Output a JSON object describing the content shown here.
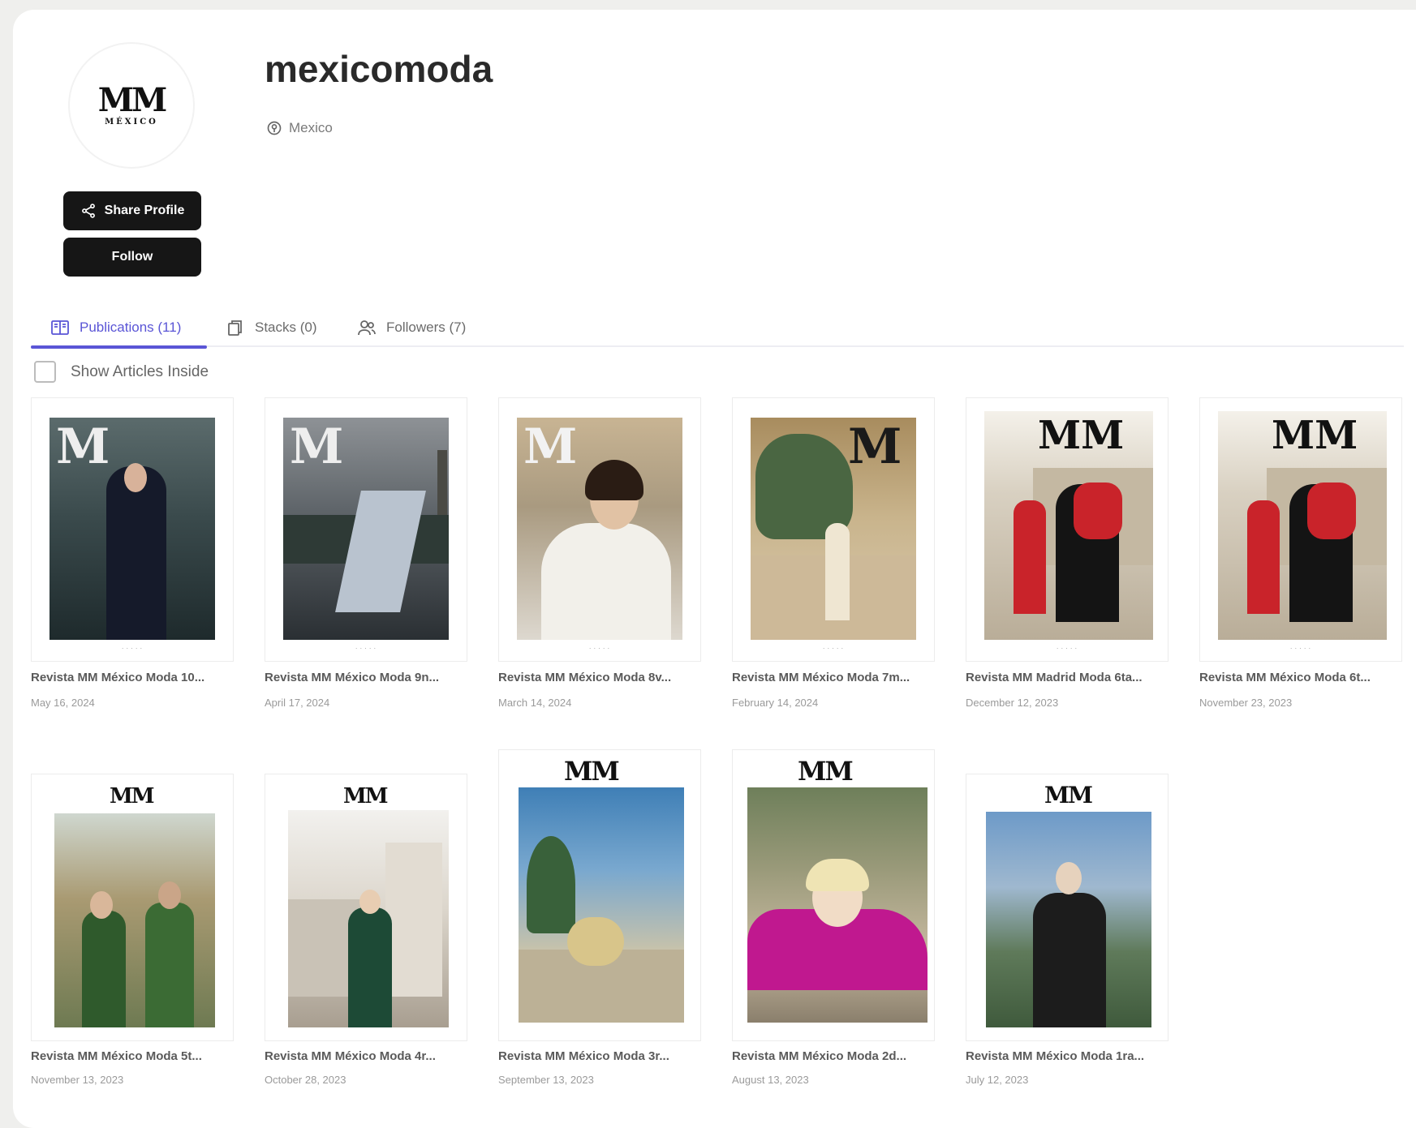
{
  "profile": {
    "name": "mexicomoda",
    "location": "Mexico",
    "logo_text": "MM",
    "logo_sub": "MÉXICO",
    "share_label": "Share Profile",
    "follow_label": "Follow"
  },
  "tabs": [
    {
      "label": "Publications (11)",
      "active": true
    },
    {
      "label": "Stacks (0)",
      "active": false
    },
    {
      "label": "Followers (7)",
      "active": false
    }
  ],
  "filter": {
    "show_articles_label": "Show Articles Inside"
  },
  "publications": [
    {
      "title": "Revista MM México Moda 10...",
      "date": "May 16, 2024"
    },
    {
      "title": "Revista MM México Moda 9n...",
      "date": "April 17, 2024"
    },
    {
      "title": "Revista MM México Moda 8v...",
      "date": "March 14, 2024"
    },
    {
      "title": "Revista MM México Moda 7m...",
      "date": "February 14, 2024"
    },
    {
      "title": "Revista MM Madrid Moda 6ta...",
      "date": "December 12, 2023"
    },
    {
      "title": "Revista MM México Moda 6t...",
      "date": "November 23, 2023"
    },
    {
      "title": "Revista MM México Moda 5t...",
      "date": "November 13, 2023"
    },
    {
      "title": "Revista MM México Moda 4r...",
      "date": "October 28, 2023"
    },
    {
      "title": "Revista MM México Moda 3r...",
      "date": "September 13, 2023"
    },
    {
      "title": "Revista MM México Moda 2d...",
      "date": "August 13, 2023"
    },
    {
      "title": "Revista MM México Moda 1ra...",
      "date": "July 12, 2023"
    }
  ],
  "colors": {
    "accent": "#5a55d6",
    "button": "#161616"
  }
}
